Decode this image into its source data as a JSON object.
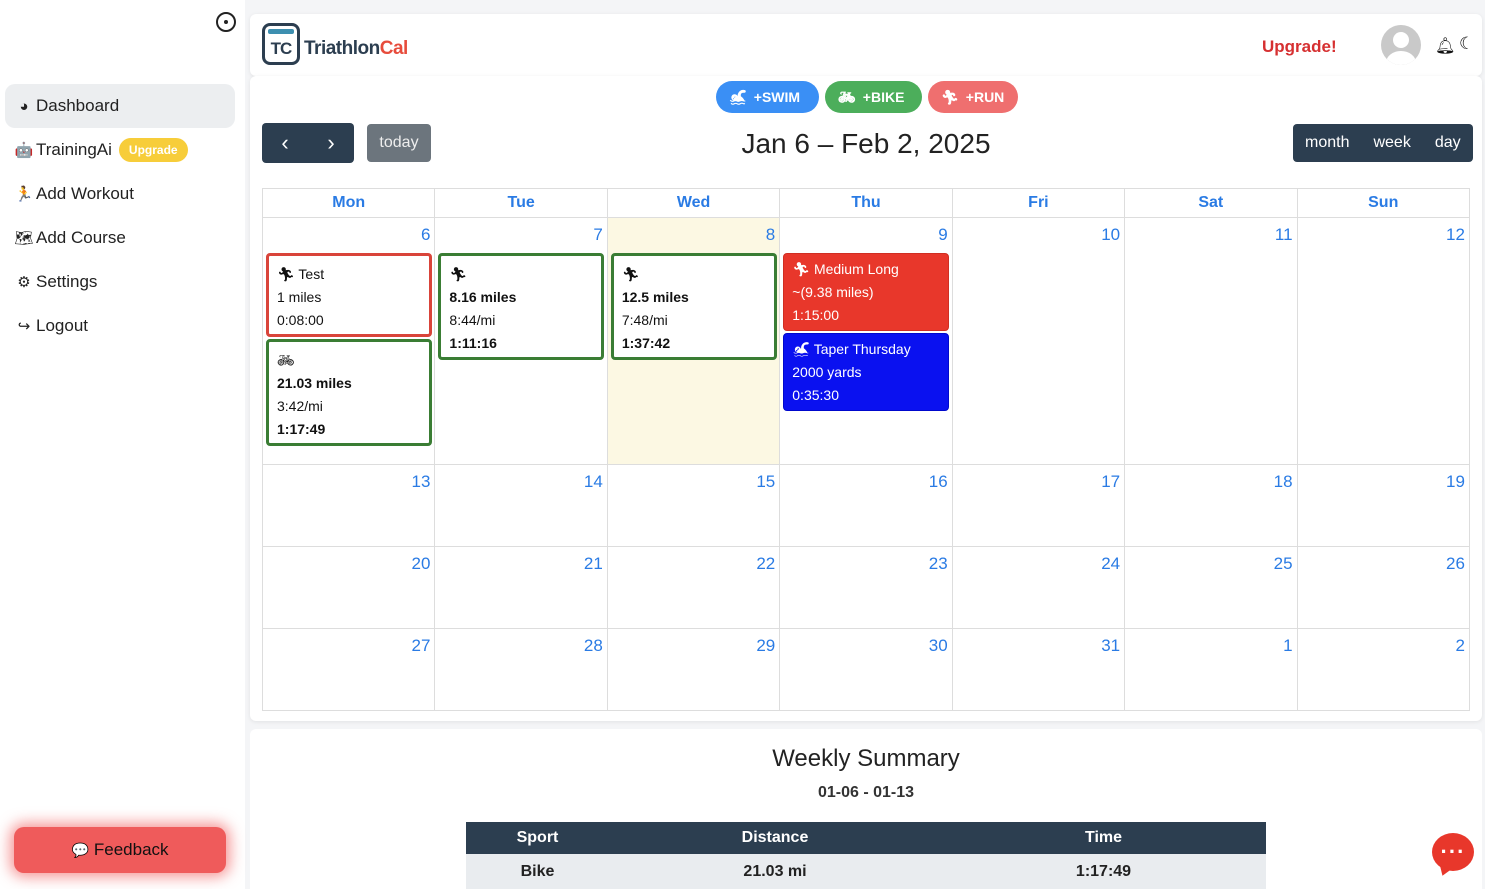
{
  "sidebar": {
    "items": [
      {
        "label": "Dashboard",
        "icon": "dashboard-icon",
        "glyph": "◕"
      },
      {
        "label": "TrainingAi",
        "icon": "robot-icon",
        "glyph": "🤖",
        "badge": "Upgrade"
      },
      {
        "label": "Add Workout",
        "icon": "run-icon",
        "glyph": "🏃"
      },
      {
        "label": "Add Course",
        "icon": "map-icon",
        "glyph": "🗺"
      },
      {
        "label": "Settings",
        "icon": "gear-icon",
        "glyph": "⚙"
      },
      {
        "label": "Logout",
        "icon": "logout-icon",
        "glyph": "↪"
      }
    ],
    "feedback_label": "Feedback"
  },
  "header": {
    "logo_mark": "TC",
    "logo_text_a": "Triathlon",
    "logo_text_b": "Cal",
    "upgrade_label": "Upgrade!"
  },
  "calendar": {
    "quick_add": {
      "swim": "+SWIM",
      "bike": "+BIKE",
      "run": "+RUN"
    },
    "today_label": "today",
    "range_title": "Jan 6 – Feb 2, 2025",
    "views": [
      "month",
      "week",
      "day"
    ],
    "weekdays": [
      "Mon",
      "Tue",
      "Wed",
      "Thu",
      "Fri",
      "Sat",
      "Sun"
    ],
    "weeks": [
      [
        "6",
        "7",
        "8",
        "9",
        "10",
        "11",
        "12"
      ],
      [
        "13",
        "14",
        "15",
        "16",
        "17",
        "18",
        "19"
      ],
      [
        "20",
        "21",
        "22",
        "23",
        "24",
        "25",
        "26"
      ],
      [
        "27",
        "28",
        "29",
        "30",
        "31",
        "1",
        "2"
      ]
    ],
    "events": {
      "mon_run": {
        "title": "Test",
        "distance": "1 miles",
        "time": "0:08:00"
      },
      "mon_bike": {
        "distance": "21.03 miles",
        "pace": "3:42/mi",
        "time": "1:17:49"
      },
      "tue_run": {
        "distance": "8.16 miles",
        "pace": "8:44/mi",
        "time": "1:11:16"
      },
      "wed_run": {
        "distance": "12.5 miles",
        "pace": "7:48/mi",
        "time": "1:37:42"
      },
      "thu_run": {
        "title": "Medium Long",
        "distance": "~(9.38 miles)",
        "time": "1:15:00"
      },
      "thu_swim": {
        "title": "Taper Thursday",
        "distance": "2000 yards",
        "time": "0:35:30"
      }
    }
  },
  "summary": {
    "title": "Weekly Summary",
    "dates": "01-06 - 01-13",
    "headers": [
      "Sport",
      "Distance",
      "Time"
    ],
    "rows": [
      [
        "Bike",
        "21.03 mi",
        "1:17:49"
      ]
    ]
  },
  "colors": {
    "primary_dark": "#2c3e50",
    "link_blue": "#2a7be4",
    "today_bg": "#fcf8e3",
    "run_red": "#e8372b",
    "swim_blue": "#0a11f0",
    "done_green": "#3a7d34"
  }
}
